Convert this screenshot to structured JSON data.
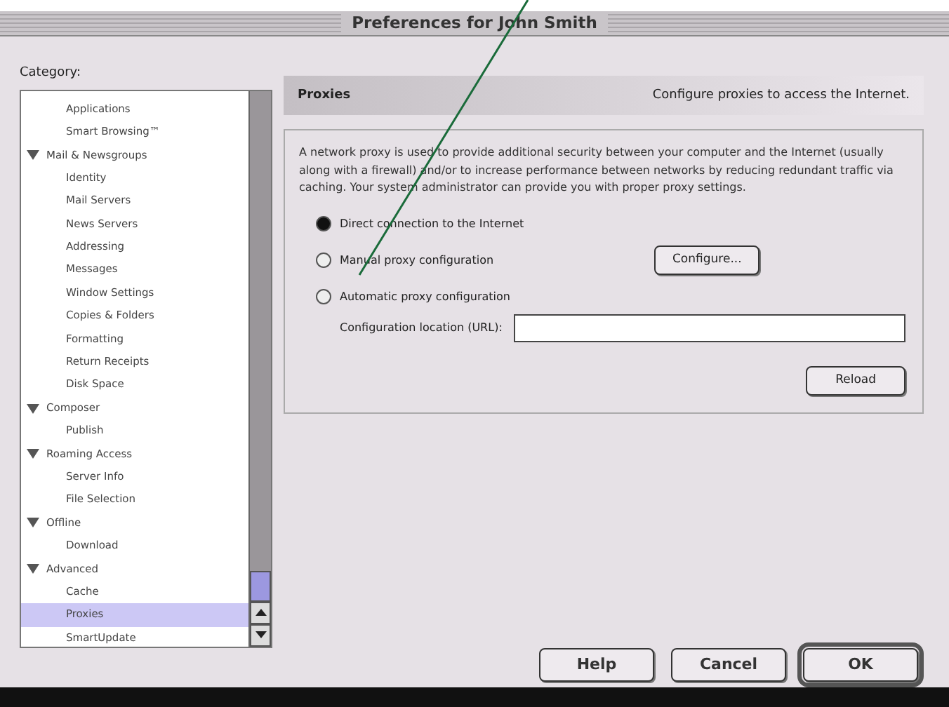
{
  "window": {
    "title": "Preferences for John Smith"
  },
  "sidebar": {
    "label": "Category:",
    "items": [
      {
        "children": [
          {
            "label": "Applications",
            "selected": false
          },
          {
            "label": "Smart Browsing™",
            "selected": false
          }
        ]
      },
      {
        "label": "Mail & Newsgroups",
        "expanded": true,
        "selected": false,
        "children": [
          {
            "label": "Identity",
            "selected": false
          },
          {
            "label": "Mail Servers",
            "selected": false
          },
          {
            "label": "News Servers",
            "selected": false
          },
          {
            "label": "Addressing",
            "selected": false
          },
          {
            "label": "Messages",
            "selected": false
          },
          {
            "label": "Window Settings",
            "selected": false
          },
          {
            "label": "Copies & Folders",
            "selected": false
          },
          {
            "label": "Formatting",
            "selected": false
          },
          {
            "label": "Return Receipts",
            "selected": false
          },
          {
            "label": "Disk Space",
            "selected": false
          }
        ]
      },
      {
        "label": "Composer",
        "expanded": true,
        "selected": false,
        "children": [
          {
            "label": "Publish",
            "selected": false
          }
        ]
      },
      {
        "label": "Roaming Access",
        "expanded": true,
        "selected": false,
        "children": [
          {
            "label": "Server Info",
            "selected": false
          },
          {
            "label": "File Selection",
            "selected": false
          }
        ]
      },
      {
        "label": "Offline",
        "expanded": true,
        "selected": false,
        "children": [
          {
            "label": "Download",
            "selected": false
          }
        ]
      },
      {
        "label": "Advanced",
        "expanded": true,
        "selected": false,
        "children": [
          {
            "label": "Cache",
            "selected": false
          },
          {
            "label": "Proxies",
            "selected": true
          },
          {
            "label": "SmartUpdate",
            "selected": false
          }
        ]
      }
    ]
  },
  "panel": {
    "title": "Proxies",
    "subtitle": "Configure proxies to access the Internet.",
    "description": "A network proxy is used to provide additional security between your computer and the Internet (usually along with a firewall) and/or to increase performance between networks by reducing redundant traffic via caching. Your system administrator can provide you with proper proxy settings.",
    "options": [
      {
        "label": "Direct connection to the Internet",
        "selected": true
      },
      {
        "label": "Manual proxy configuration",
        "selected": false,
        "button": "Configure..."
      },
      {
        "label": "Automatic proxy configuration",
        "selected": false
      }
    ],
    "url_label": "Configuration location (URL):",
    "reload": "Reload"
  },
  "buttons": [
    {
      "label": "Help",
      "default": false
    },
    {
      "label": "Cancel",
      "default": false
    },
    {
      "label": "OK",
      "default": true
    }
  ]
}
